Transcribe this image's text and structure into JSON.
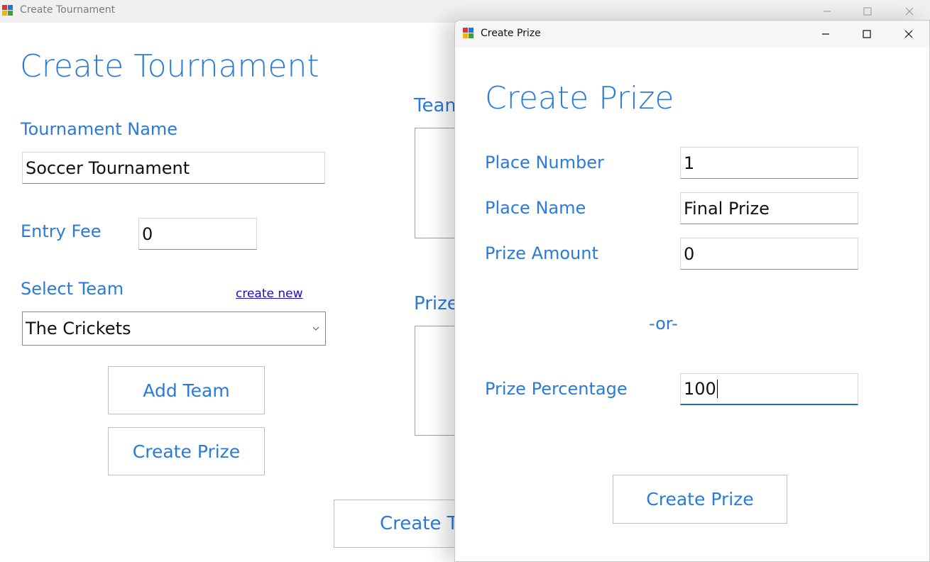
{
  "main_window": {
    "title": "Create Tournament",
    "heading": "Create Tournament",
    "tournament_name_label": "Tournament Name",
    "tournament_name_value": "Soccer Tournament",
    "entry_fee_label": "Entry Fee",
    "entry_fee_value": "0",
    "select_team_label": "Select Team",
    "create_new_link": "create new",
    "selected_team": "The Crickets",
    "add_team_button": "Add Team",
    "create_prize_button": "Create Prize",
    "teams_label_partial": "Team",
    "prizes_label_partial": "Prize",
    "create_tournament_button_partial": "Create To"
  },
  "prize_window": {
    "title": "Create Prize",
    "heading": "Create Prize",
    "place_number_label": "Place Number",
    "place_number_value": "1",
    "place_name_label": "Place Name",
    "place_name_value": "Final Prize",
    "prize_amount_label": "Prize Amount",
    "prize_amount_value": "0",
    "or_separator": "-or-",
    "prize_percentage_label": "Prize Percentage",
    "prize_percentage_value": "100",
    "create_prize_button": "Create Prize"
  },
  "colors": {
    "accent": "#2a7bd8",
    "link": "#1a0dce",
    "focus_underline": "#1f6fc2"
  },
  "icons": [
    "app-icon",
    "minimize-icon",
    "maximize-icon",
    "close-icon",
    "chevron-down-icon"
  ]
}
